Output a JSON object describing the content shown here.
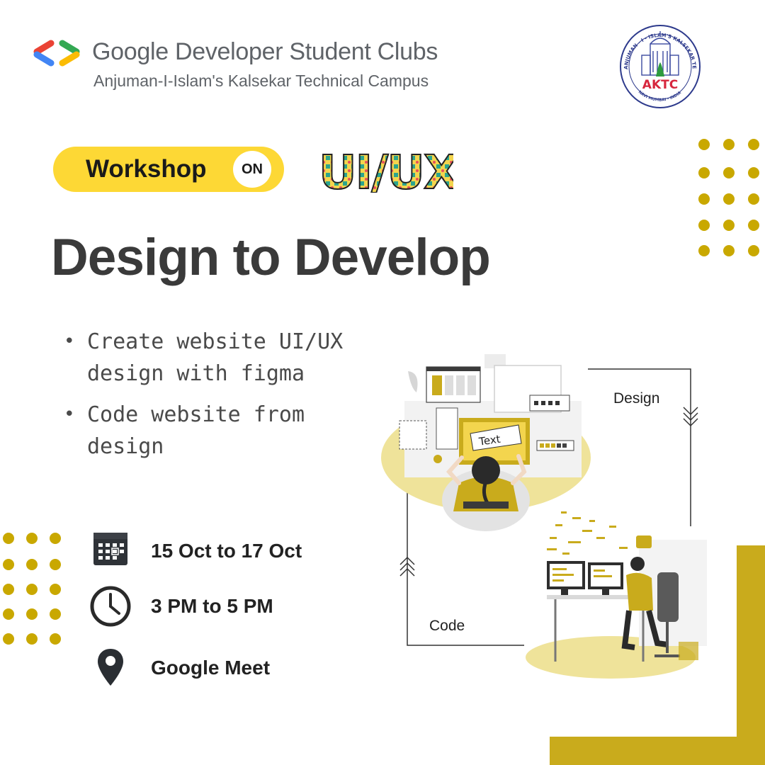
{
  "header": {
    "org_title": "Google Developer Student Clubs",
    "org_subtitle": "Anjuman-I-Islam's Kalsekar Technical Campus",
    "seal_text": "ANJUMAN - I - ISLAM'S KALSEKAR TECHNICAL CAMPUS, NEW PANVEL",
    "seal_abbr": "AKTC",
    "seal_location": "NAVI MUMBAI - INDIA"
  },
  "event": {
    "tag_label": "Workshop",
    "on_label": "ON",
    "topic_art_text": "UI/UX",
    "headline": "Design to Develop",
    "bullets": [
      "Create website UI/UX\ndesign with figma",
      "Code website from\ndesign"
    ],
    "date": "15 Oct to 17 Oct",
    "time": "3 PM to 5 PM",
    "venue": "Google Meet"
  },
  "diagram": {
    "design_label": "Design",
    "code_label": "Code",
    "illustration_text": "Text"
  },
  "colors": {
    "accent_yellow": "#fdd835",
    "mustard": "#c9a800",
    "dark_text": "#3a3a3a",
    "gdsc_blue": "#4285f4",
    "gdsc_red": "#ea4335",
    "gdsc_green": "#34a853",
    "gdsc_yellow": "#fbbc04"
  },
  "icons": {
    "logo": "gdsc-brackets-logo",
    "date": "calendar-icon",
    "time": "clock-icon",
    "venue": "location-pin-icon"
  }
}
